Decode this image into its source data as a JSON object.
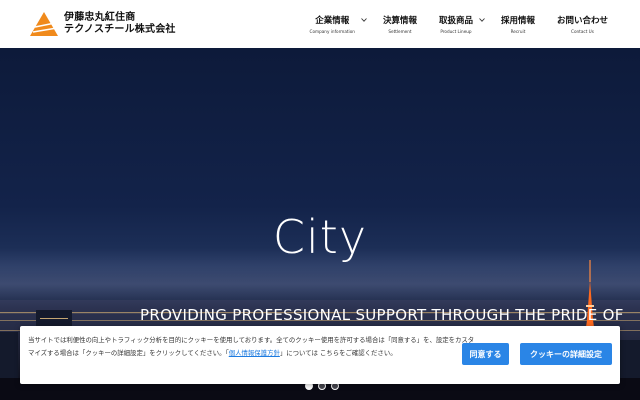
{
  "company": {
    "name_line1": "伊藤忠丸紅住商",
    "name_line2": "テクノスチール株式会社"
  },
  "nav": [
    {
      "ja": "企業情報",
      "en": "Company information",
      "has_sub": true
    },
    {
      "ja": "決算情報",
      "en": "Settlement",
      "has_sub": false
    },
    {
      "ja": "取扱商品",
      "en": "Product Lineup",
      "has_sub": true
    },
    {
      "ja": "採用情報",
      "en": "Recruit",
      "has_sub": false
    },
    {
      "ja": "お問い合わせ",
      "en": "Contact Us",
      "has_sub": false
    }
  ],
  "hero": {
    "title": "City",
    "subtitle": "PROVIDING PROFESSIONAL SUPPORT THROUGH THE PRIDE OF",
    "slide_count": 3,
    "active_slide": 1
  },
  "cookie": {
    "text_before_link": "当サイトでは利便性の向上やトラフィック分析を目的にクッキーを使用しております。全てのクッキー使用を許可する場合は「同意する」を、設定をカスタマイズする場合は「クッキーの詳細設定」をクリックしてください。「",
    "link_text": "個人情報保護方針",
    "text_after_link": "」については こちらをご確認ください。",
    "agree_label": "同意する",
    "settings_label": "クッキーの詳細設定"
  },
  "colors": {
    "accent_orange": "#f08a1c",
    "button_blue": "#2a85e6",
    "hero_sky": "#0d1a3a"
  }
}
